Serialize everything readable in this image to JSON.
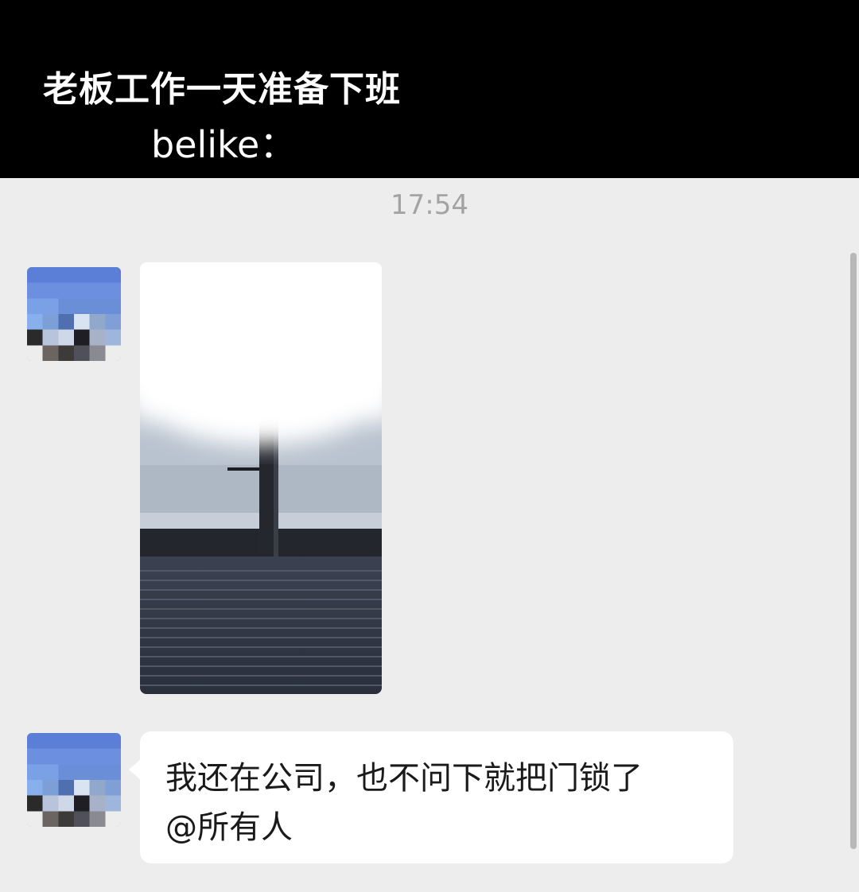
{
  "caption": {
    "line1": "老板工作一天准备下班",
    "line2": "belike："
  },
  "chat": {
    "timestamp": "17:54",
    "messages": [
      {
        "type": "image",
        "sender_avatar": "pixelated-avatar"
      },
      {
        "type": "text",
        "lines": [
          "我还在公司，也不问下就把门锁了",
          "@所有人"
        ]
      }
    ]
  },
  "colors": {
    "caption_bg": "#000000",
    "chat_bg": "#ededed",
    "bubble_bg": "#ffffff",
    "timestamp_text": "#a3a3a3"
  }
}
